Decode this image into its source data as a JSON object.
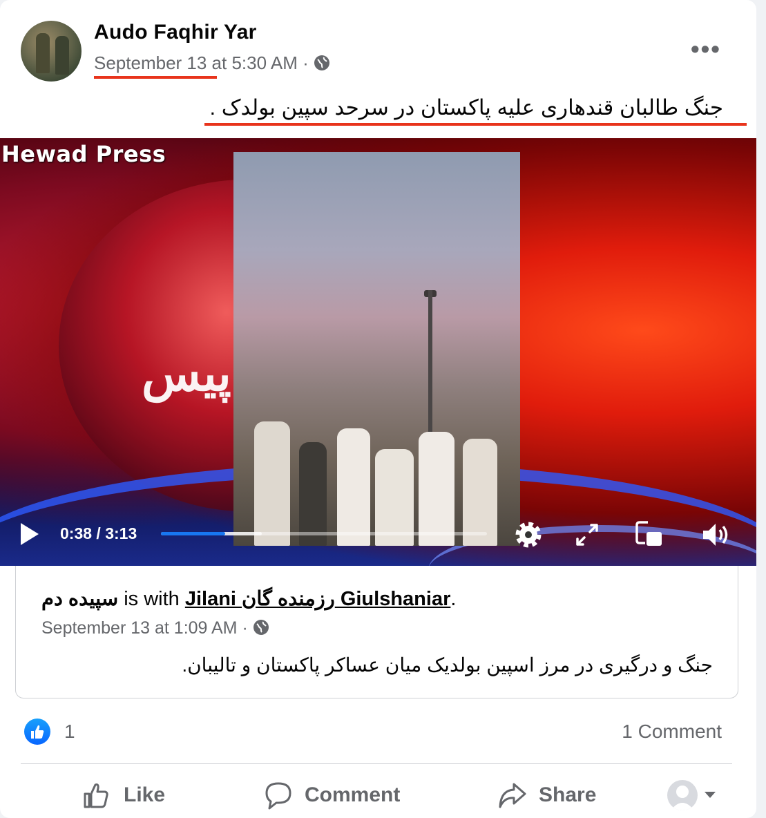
{
  "post": {
    "author": "Audo Faqhir Yar",
    "date": "September 13",
    "time_suffix": " at 5:30 AM · ",
    "audience_icon": "globe-icon",
    "more_icon": "more-dots-icon",
    "more_text": "•••",
    "caption": "جنگ طالبان قندهاری علیه پاکستان در سرحد سپین بولدک ."
  },
  "video": {
    "watermark": "Hewad Press",
    "overlay_script": "پیس",
    "current_time": "0:38",
    "separator": " / ",
    "duration": "3:13",
    "progress_fraction": 0.197,
    "buffered_fraction": 0.31,
    "icons": [
      "play-icon",
      "settings-icon",
      "fullscreen-icon",
      "picture-in-picture-icon",
      "volume-icon"
    ]
  },
  "shared": {
    "page_name": "سپیده دم",
    "with_text": " is with ",
    "tagged": "Jilani رزمنده گان Giulshaniar",
    "period": ".",
    "meta": "September 13 at 1:09 AM · ",
    "text": "جنگ و درگیری در مرز اسپین بولدیک میان عساکر پاکستان و تالیبان."
  },
  "stats": {
    "likes": "1",
    "comments": "1 Comment"
  },
  "actions": {
    "like": "Like",
    "comment": "Comment",
    "share": "Share"
  },
  "colors": {
    "accent": "#1877f2",
    "annotation_red": "#e8341c",
    "muted_text": "#65676b"
  }
}
